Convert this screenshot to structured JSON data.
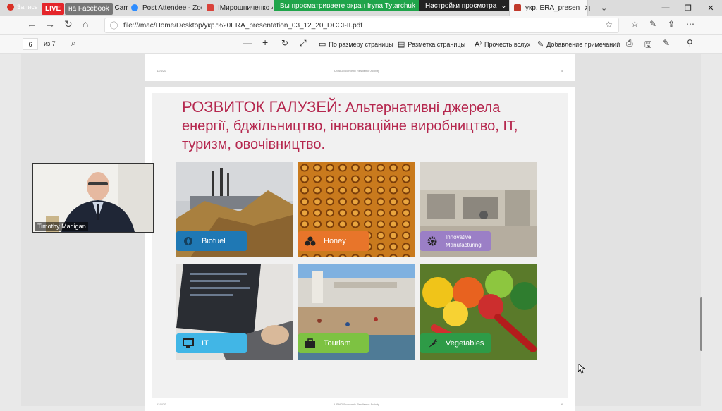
{
  "tabbar": {
    "recording_label": "Запись",
    "live_badge": "LIVE",
    "facebook_badge": "на Facebook",
    "tabs": [
      {
        "title": "Agenda-Biz Camp fo",
        "fav_color": "#3b6fb6"
      },
      {
        "title": "Post Attendee - Zoor",
        "fav_color": "#2d8cff"
      },
      {
        "title": "IМирошниченко 4М",
        "fav_color": "#d9423a"
      },
      {
        "title": "укр. ERA_presen",
        "fav_color": "#c0392b"
      }
    ],
    "zoom_share_text": "Вы просматриваете экран Iryna Tytarchuk",
    "zoom_options_text": "Настройки просмотра",
    "new_tab": "+"
  },
  "address": {
    "url": "file:///mac/Home/Desktop/укр.%20ERA_presentation_03_12_20_DCCI-II.pdf"
  },
  "pdf_toolbar": {
    "page_current": "6",
    "page_total": "из 7",
    "fit_label": "По размеру страницы",
    "layout_label": "Разметка страницы",
    "read_aloud_label": "Прочесть вслух",
    "annotate_label": "Добавление примечаний"
  },
  "prev_page": {
    "footer_date": "12/3/20",
    "footer_center": "USAID Economic Resilience Activity",
    "footer_num": "5"
  },
  "slide": {
    "title_main": "РОЗВИТОК ГАЛУЗЕЙ",
    "title_rest": ": Альтернативні джерела енергії, бджільництво, інноваційне виробництво, IT, туризм, овочівництво.",
    "footer_date": "12/3/20",
    "footer_center": "USAID Economic Resilience Activity",
    "footer_num": "6",
    "tiles": [
      {
        "label": "Biofuel",
        "color": "#1f78b4",
        "icon": "leaf-icon"
      },
      {
        "label": "Honey",
        "color": "#e8752a",
        "icon": "circles-icon"
      },
      {
        "label": "Innovative Manufacturing",
        "color": "#9b7fc6",
        "icon": "gear-icon"
      },
      {
        "label": "IT",
        "color": "#41b6e6",
        "icon": "monitor-icon"
      },
      {
        "label": "Tourism",
        "color": "#7dc242",
        "icon": "suitcase-icon"
      },
      {
        "label": "Vegetables",
        "color": "#2e9b47",
        "icon": "carrot-icon"
      }
    ]
  },
  "video": {
    "participant_name": "Timothy Madigan"
  }
}
